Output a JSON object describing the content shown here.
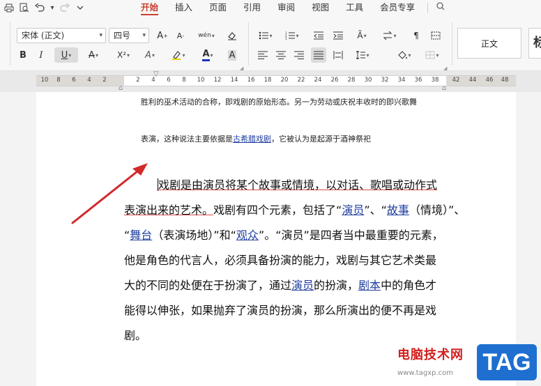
{
  "quick_access": {
    "icons": [
      "print-icon",
      "print-preview-icon",
      "undo-icon",
      "undo-dropdown-icon",
      "redo-icon",
      "customize-dropdown-icon"
    ]
  },
  "tabs": [
    "开始",
    "插入",
    "页面",
    "引用",
    "审阅",
    "视图",
    "工具",
    "会员专享"
  ],
  "active_tab": "开始",
  "ribbon": {
    "font_name": "宋体 (正文)",
    "font_size": "四号",
    "grow_font": "A",
    "shrink_font": "A",
    "pinyin": "wén",
    "bold": "B",
    "italic": "I",
    "underline": "U",
    "strike": "A",
    "superscript": "X²",
    "text_effect": "A",
    "font_color": "A",
    "char_shading": "A",
    "style_normal": "正文",
    "style_next": "标"
  },
  "ruler": {
    "ticks": [
      "10",
      "8",
      "6",
      "4",
      "2",
      "2",
      "4",
      "6",
      "8",
      "10",
      "12",
      "14",
      "16",
      "18",
      "20",
      "22",
      "24",
      "26",
      "28",
      "30",
      "32",
      "34",
      "36",
      "38",
      "42",
      "44",
      "46",
      "48"
    ]
  },
  "document": {
    "line_1": "胜利的巫术活动的合称，即戏剧的原始形态。另一为劳动或庆祝丰收时的即兴歌舞",
    "line_2_before": "表演，这种说法主要依据是",
    "line_2_link": "古希腊戏剧",
    "line_2_after": "，它被认为是起源于酒神祭祀",
    "para": {
      "l1": "戏剧是由演员将某个故事或情境，以对话、歌唱或动作式",
      "l2_a": "表演出来的艺术。",
      "l2_b": "戏剧有四个元素，包括了“",
      "l2_link1": "演员",
      "l2_c": "”、“",
      "l2_link2": "故事",
      "l2_d": "（情境）”、",
      "l3_a": "“",
      "l3_link1": "舞台",
      "l3_b": "（表演场地）”和“",
      "l3_link2": "观众",
      "l3_c": "”。“演员”是四者当中最重要的元素，",
      "l4": "他是角色的代言人，必须具备扮演的能力，戏剧与其它艺术类最",
      "l5_a": "大的不同的处便在于扮演了，通过",
      "l5_link1": "演员",
      "l5_b": "的扮演，",
      "l5_link2": "剧本",
      "l5_c": "中的角色才",
      "l6": "能得以伸张，如果抛弃了演员的扮演，那么所演出的便不再是戏",
      "l7": "剧。"
    }
  },
  "watermark": {
    "site_name": "电脑技术网",
    "url": "www.tagxp.com",
    "tag": "TAG"
  },
  "colors": {
    "accent": "#c8402c",
    "link": "#1f3ea0",
    "arrow": "#d22a2a",
    "tag_bg": "#1e6fd0"
  }
}
